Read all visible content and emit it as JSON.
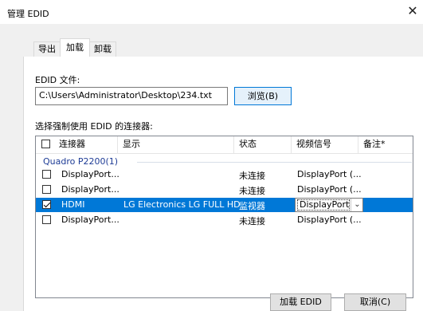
{
  "window": {
    "title": "管理 EDID",
    "close_glyph": "✕"
  },
  "tabs": [
    {
      "label": "导出",
      "active": false
    },
    {
      "label": "加载",
      "active": true
    },
    {
      "label": "卸载",
      "active": false
    }
  ],
  "edid_file": {
    "label": "EDID 文件:",
    "path_value": "C:\\Users\\Administrator\\Desktop\\234.txt",
    "browse_label": "浏览(B)"
  },
  "connectors": {
    "label": "选择强制使用 EDID 的连接器:",
    "columns": [
      "连接器",
      "显示",
      "状态",
      "视频信号",
      "备注*"
    ],
    "group": "Quadro P2200(1)",
    "rows": [
      {
        "checked": false,
        "connector": "DisplayPort...",
        "display": "",
        "status": "未连接",
        "signal": "DisplayPort (...",
        "selected": false
      },
      {
        "checked": false,
        "connector": "DisplayPort...",
        "display": "",
        "status": "未连接",
        "signal": "DisplayPort (...",
        "selected": false
      },
      {
        "checked": true,
        "connector": "HDMI",
        "display": "LG Electronics LG FULL HD",
        "status": "监视器",
        "signal": "DisplayPort (",
        "selected": true
      },
      {
        "checked": false,
        "connector": "DisplayPort...",
        "display": "",
        "status": "未连接",
        "signal": "DisplayPort (...",
        "selected": false
      }
    ]
  },
  "footer": {
    "load_label": "加载 EDID",
    "cancel_label": "取消(C)"
  },
  "colors": {
    "selection": "#0078d7",
    "group_title": "#1e3c96"
  }
}
